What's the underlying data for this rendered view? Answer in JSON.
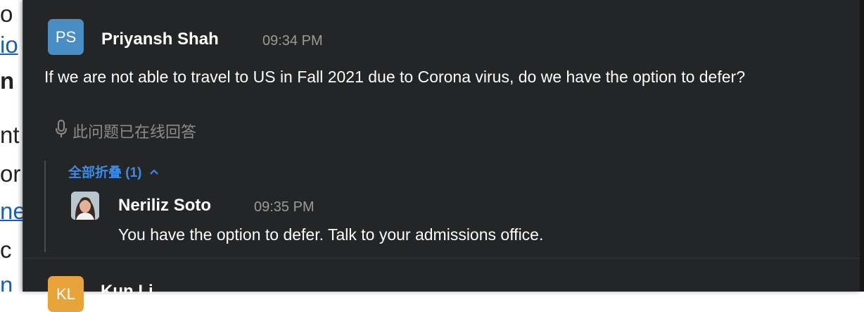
{
  "background_document": {
    "fragments": [
      "o",
      "io",
      "n",
      "nt",
      "or",
      "ne",
      "c",
      "n"
    ]
  },
  "messages": [
    {
      "avatar_initials": "PS",
      "author": "Priyansh Shah",
      "time": "09:34 PM",
      "text": "If we are not able to travel to US in Fall 2021 due to Corona virus, do we have the option to defer?",
      "answered_status": "此问题已在线回答",
      "answered_icon": "microphone-icon",
      "collapse_label": "全部折叠 (1)",
      "collapse_icon": "chevron-up-icon",
      "replies": [
        {
          "author": "Neriliz Soto",
          "time": "09:35 PM",
          "text": "You have the option to defer. Talk to your admissions office."
        }
      ]
    },
    {
      "avatar_initials": "KL",
      "author": "Kun Li"
    }
  ],
  "colors": {
    "panel_bg": "#242526",
    "link_blue": "#3b8beb",
    "avatar_ps": "#4a8dc4",
    "avatar_kl": "#e8a33a"
  }
}
